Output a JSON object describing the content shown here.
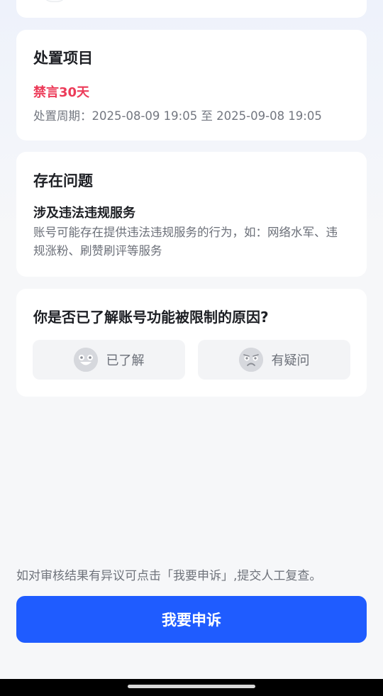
{
  "penalty": {
    "title": "处置项目",
    "item": "禁言30天",
    "period": "处置周期：2025-08-09 19:05 至 2025-09-08 19:05"
  },
  "issue": {
    "title": "存在问题",
    "name": "涉及违法违规服务",
    "description": "账号可能存在提供违法违规服务的行为，如：网络水军、违规涨粉、刷赞刷评等服务"
  },
  "feedback": {
    "question": "你是否已了解账号功能被限制的原因?",
    "options": [
      {
        "label": "已了解",
        "icon": "smiling-face-icon"
      },
      {
        "label": "有疑问",
        "icon": "confused-face-icon"
      }
    ]
  },
  "footer": {
    "note": "如对审核结果有异议可点击「我要申诉」,提交人工复查。",
    "appeal_button": "我要申诉"
  },
  "colors": {
    "accent": "#1f5cff",
    "penalty_text": "#ec3b59",
    "background": "#f6f7f9"
  }
}
